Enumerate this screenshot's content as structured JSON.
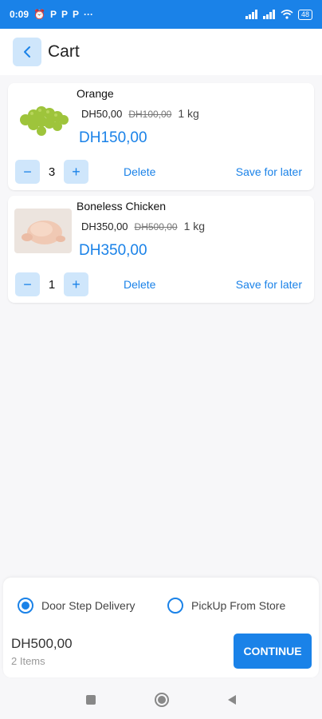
{
  "status_bar": {
    "time": "0:09",
    "notification_icons": [
      "P",
      "P",
      "P"
    ],
    "more": "···",
    "battery": "48"
  },
  "header": {
    "title": "Cart",
    "back_icon": "chevron-left-icon"
  },
  "cart": {
    "items": [
      {
        "name": "Orange",
        "price": "DH50,00",
        "old_price": "DH100,00",
        "unit": "1 kg",
        "total": "DH150,00",
        "quantity": "3",
        "delete_label": "Delete",
        "save_label": "Save for later",
        "image": "grapes"
      },
      {
        "name": "Boneless Chicken",
        "price": "DH350,00",
        "old_price": "DH500,00",
        "unit": "1 kg",
        "total": "DH350,00",
        "quantity": "1",
        "delete_label": "Delete",
        "save_label": "Save for later",
        "image": "chicken"
      }
    ],
    "minus": "−",
    "plus": "+"
  },
  "checkout": {
    "options": [
      {
        "label": "Door Step Delivery",
        "selected": true
      },
      {
        "label": "PickUp From Store",
        "selected": false
      }
    ],
    "total": "DH500,00",
    "count": "2 Items",
    "continue_label": "CONTINUE"
  },
  "colors": {
    "accent": "#1a82e8",
    "accent_light": "#cfe6fb",
    "background": "#f7f7f9"
  }
}
